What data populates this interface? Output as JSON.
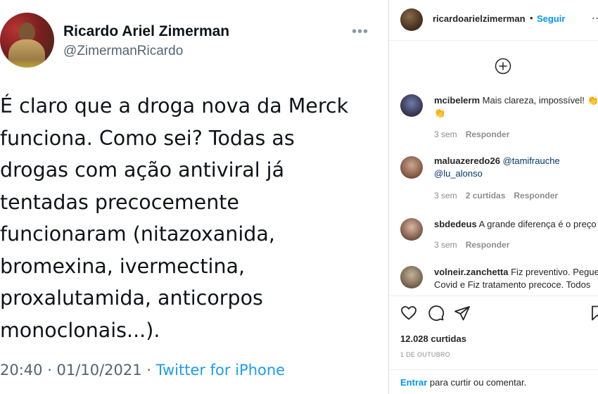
{
  "tweet": {
    "display_name": "Ricardo Ariel Zimerman",
    "handle": "@ZimermanRicardo",
    "more": "•••",
    "text": "É claro que a droga nova da Merck\nfunciona. Como sei? Todas as\ndrogas com ação antiviral já\ntentadas precocemente\nfuncionaram (nitazoxanida,\nbromexina, ivermectina,\nproxalutamida, anticorpos\nmonoclonais...).",
    "timestamp": "20:40 · 01/10/2021 · ",
    "source": "Twitter for iPhone"
  },
  "instagram": {
    "header": {
      "username": "ricardoarielzimerman",
      "separator": "•",
      "follow_label": "Seguir",
      "menu": "..."
    },
    "comments": [
      {
        "username": "mcibelerm",
        "text": "Mais clareza, impossível! 👏",
        "text_line2": "👏",
        "time": "3 sem",
        "likes": "",
        "reply": "Responder"
      },
      {
        "username": "maluazeredo26",
        "text": "@tamifrauche",
        "text_line2": "@lu_alonso",
        "time": "3 sem",
        "likes": "2 curtidas",
        "reply": "Responder"
      },
      {
        "username": "sbdedeus",
        "text": "A grande diferença é o preço",
        "text_line2": "",
        "time": "3 sem",
        "likes": "",
        "reply": "Responder"
      },
      {
        "username": "volneir.zanchetta",
        "text": "Fiz preventivo. Pegue",
        "text_line2": "Covid e Fiz tratamento precoce. Todos"
      }
    ],
    "likes_count": "12.028 curtidas",
    "date": "1 DE OUTUBRO",
    "login_link": "Entrar",
    "login_text": " para curtir ou comentar."
  },
  "icons": [
    "plus-circle-icon",
    "heart-icon",
    "comment-icon",
    "share-icon",
    "save-icon"
  ]
}
